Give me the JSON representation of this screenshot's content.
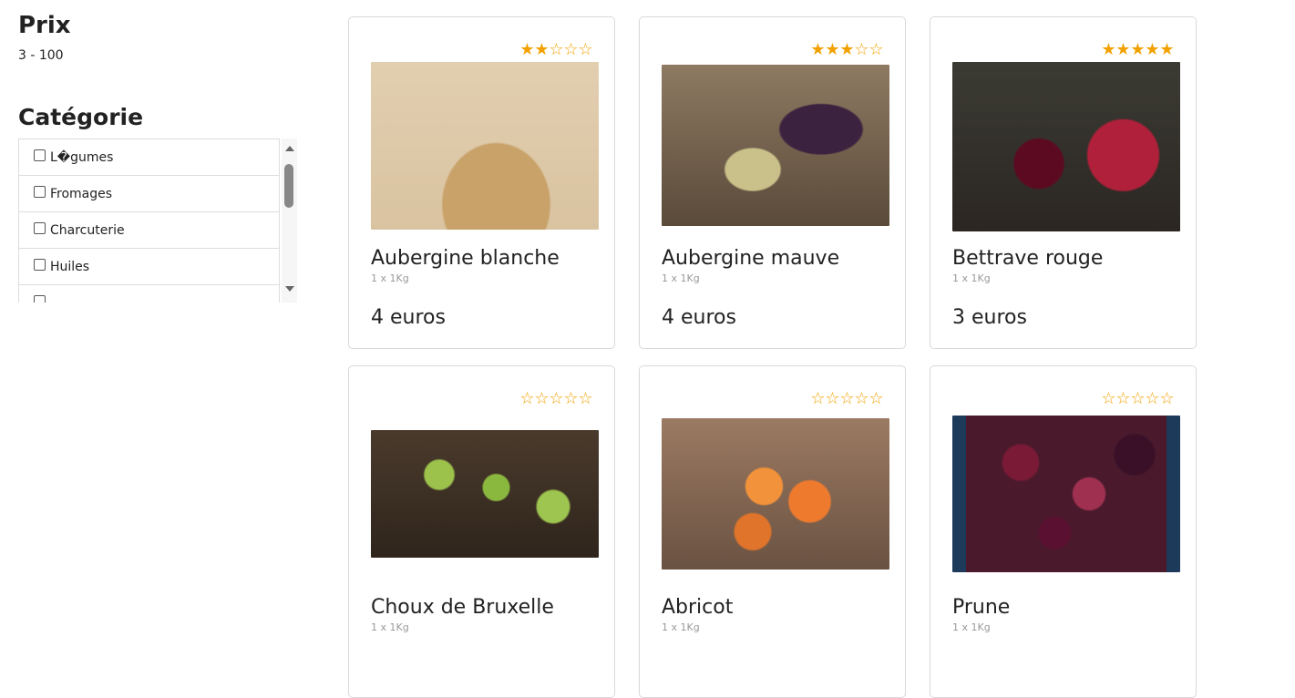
{
  "filters": {
    "price_title": "Prix",
    "price_range": "3 - 100",
    "category_title": "Catégorie",
    "categories": [
      "L�gumes",
      "Fromages",
      "Charcuterie",
      "Huiles"
    ]
  },
  "accent_color": "#f2a100",
  "products": [
    {
      "name": "Aubergine blanche",
      "unit": "1 x 1Kg",
      "price": "4 euros",
      "rating": 2,
      "max_rating": 5,
      "image": "white-eggplant-image"
    },
    {
      "name": "Aubergine mauve",
      "unit": "1 x 1Kg",
      "price": "4 euros",
      "rating": 3,
      "max_rating": 5,
      "image": "purple-eggplant-image"
    },
    {
      "name": "Bettrave rouge",
      "unit": "1 x 1Kg",
      "price": "3 euros",
      "rating": 5,
      "max_rating": 5,
      "image": "red-beet-image"
    },
    {
      "name": "Choux de Bruxelle",
      "unit": "1 x 1Kg",
      "price": "",
      "rating": 0,
      "max_rating": 5,
      "image": "brussels-sprouts-image"
    },
    {
      "name": "Abricot",
      "unit": "1 x 1Kg",
      "price": "",
      "rating": 0,
      "max_rating": 5,
      "image": "apricot-image"
    },
    {
      "name": "Prune",
      "unit": "1 x 1Kg",
      "price": "",
      "rating": 0,
      "max_rating": 5,
      "image": "plum-image"
    }
  ]
}
